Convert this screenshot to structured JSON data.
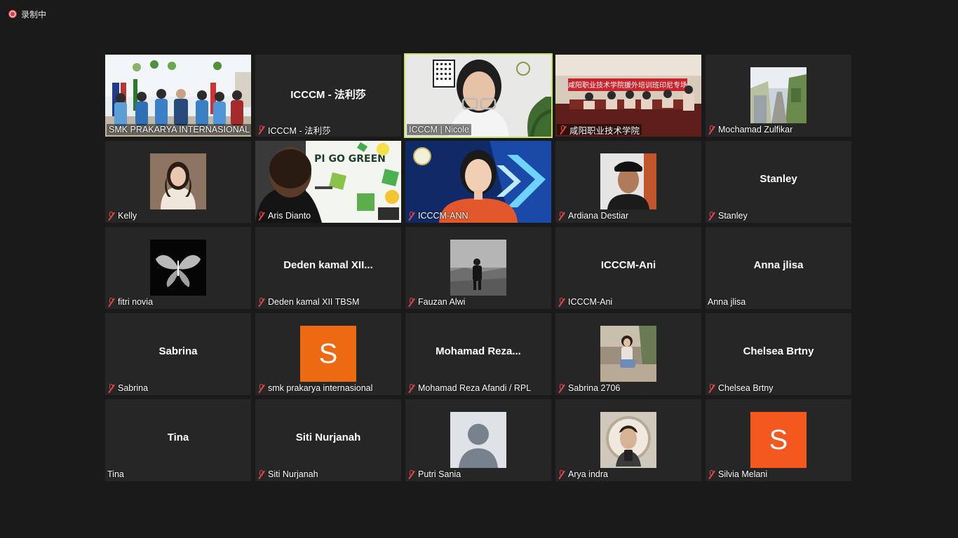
{
  "recording": {
    "label": "录制中"
  },
  "colors": {
    "active_border": "#c7e36a",
    "mute_red": "#e04646",
    "avatar_orange": "#ee6a12",
    "avatar_orange2": "#f4581f"
  },
  "participants": [
    {
      "name": "SMK PRAKARYA INTERNASIONAL",
      "muted": false,
      "media": "video"
    },
    {
      "name": "ICCCM - 法利莎",
      "display": "ICCCM - 法利莎",
      "muted": true,
      "media": "name"
    },
    {
      "name": "ICCCM | Nicole",
      "muted": false,
      "media": "video",
      "active": true
    },
    {
      "name": "咸阳职业技术学院",
      "muted": true,
      "media": "video",
      "banner": "咸阳职业技术学院援外培训班印尼专场"
    },
    {
      "name": "Mochamad Zulfikar",
      "muted": true,
      "media": "photo"
    },
    {
      "name": "Kelly",
      "muted": true,
      "media": "photo"
    },
    {
      "name": "Aris Dianto",
      "muted": true,
      "media": "video",
      "banner": "PI GO GREEN"
    },
    {
      "name": "ICCCM-ANN",
      "muted": true,
      "media": "video"
    },
    {
      "name": "Ardiana Destiar",
      "muted": true,
      "media": "photo"
    },
    {
      "name": "Stanley",
      "display": "Stanley",
      "muted": true,
      "media": "name"
    },
    {
      "name": "fitri novia",
      "muted": true,
      "media": "photo"
    },
    {
      "name": "Deden kamal XII TBSM",
      "display": "Deden  kamal  XII...",
      "muted": true,
      "media": "name"
    },
    {
      "name": "Fauzan Alwi",
      "muted": true,
      "media": "photo"
    },
    {
      "name": "ICCCM-Ani",
      "display": "ICCCM-Ani",
      "muted": true,
      "media": "name"
    },
    {
      "name": "Anna jlisa",
      "display": "Anna jlisa",
      "muted": false,
      "media": "name"
    },
    {
      "name": "Sabrina",
      "display": "Sabrina",
      "muted": true,
      "media": "name"
    },
    {
      "name": "smk prakarya internasional",
      "muted": true,
      "media": "avatar",
      "initial": "S"
    },
    {
      "name": "Mohamad Reza Afandi / RPL",
      "display": "Mohamad  Reza...",
      "muted": true,
      "media": "name"
    },
    {
      "name": "Sabrina 2706",
      "muted": true,
      "media": "photo"
    },
    {
      "name": "Chelsea Brtny",
      "display": "Chelsea Brtny",
      "muted": true,
      "media": "name"
    },
    {
      "name": "Tina",
      "display": "Tina",
      "muted": false,
      "media": "name"
    },
    {
      "name": "Siti Nurjanah",
      "display": "Siti Nurjanah",
      "muted": true,
      "media": "name"
    },
    {
      "name": "Putri Sania",
      "muted": true,
      "media": "default-avatar"
    },
    {
      "name": "Arya indra",
      "muted": true,
      "media": "photo"
    },
    {
      "name": "Silvia Melani",
      "muted": true,
      "media": "avatar",
      "initial": "S"
    }
  ]
}
